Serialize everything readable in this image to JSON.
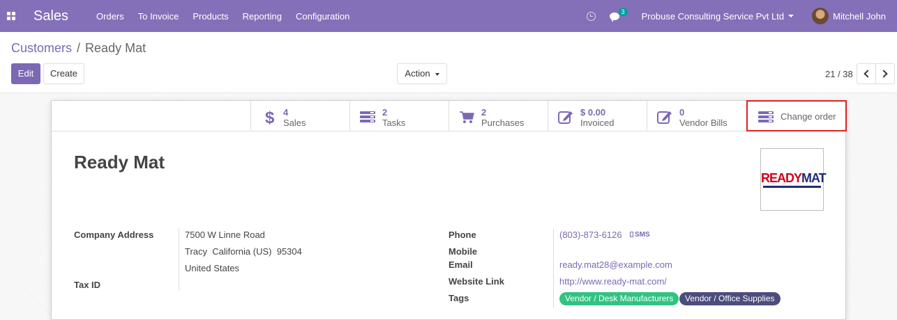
{
  "navbar": {
    "app_name": "Sales",
    "menu": [
      "Orders",
      "To Invoice",
      "Products",
      "Reporting",
      "Configuration"
    ],
    "chat_count": "3",
    "company": "Probuse Consulting Service Pvt Ltd",
    "user": "Mitchell John",
    "bg_color": "#8470b8"
  },
  "breadcrumb": {
    "parent": "Customers",
    "separator": "/",
    "current": "Ready Mat"
  },
  "toolbar": {
    "edit_label": "Edit",
    "create_label": "Create",
    "action_label": "Action"
  },
  "pager": {
    "value": "21 / 38"
  },
  "stat_buttons": [
    {
      "icon": "dollar-icon",
      "value": "4",
      "label": "Sales"
    },
    {
      "icon": "tasks-icon",
      "value": "2",
      "label": "Tasks"
    },
    {
      "icon": "cart-icon",
      "value": "2",
      "label": "Purchases"
    },
    {
      "icon": "pencil-square-icon",
      "value": "$ 0.00",
      "label": "Invoiced"
    },
    {
      "icon": "pencil-square-icon",
      "value": "0",
      "label": "Vendor Bills"
    },
    {
      "icon": "tasks-icon",
      "label": "Change order"
    }
  ],
  "record": {
    "name": "Ready Mat",
    "logo_part1": "READY",
    "logo_part2": "MAT",
    "address_label": "Company Address",
    "address_line1": "7500 W Linne Road",
    "address_line2": "Tracy  California (US)  95304",
    "address_line3": "United States",
    "tax_label": "Tax ID",
    "phone_label": "Phone",
    "phone": "(803)-873-6126",
    "sms_label": "SMS",
    "mobile_label": "Mobile",
    "email_label": "Email",
    "email": "ready.mat28@example.com",
    "website_label": "Website Link",
    "website": "http://www.ready-mat.com/",
    "tags_label": "Tags",
    "tags": [
      {
        "label": "Vendor / Desk Manufacturers",
        "color": "#30c381"
      },
      {
        "label": "Vendor / Office Supplies",
        "color": "#4c4c7e"
      }
    ]
  },
  "colors": {
    "accent": "#7c68b4",
    "highlight_border": "#e02020"
  }
}
